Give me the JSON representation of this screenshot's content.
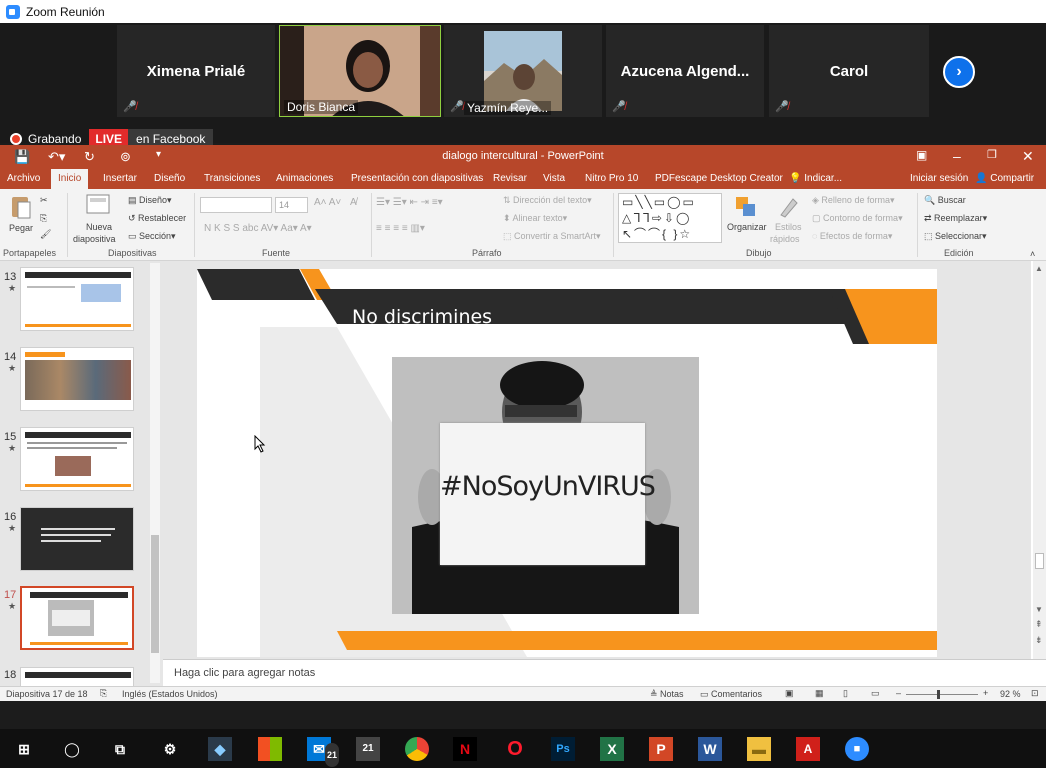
{
  "window": {
    "title": "Zoom Reunión"
  },
  "participants": [
    {
      "name": "Ximena Prialé",
      "muted": true
    },
    {
      "name": "Doris Bianca",
      "muted": false,
      "video": true
    },
    {
      "name": "Yazmín Reye...",
      "muted": true,
      "photo": true
    },
    {
      "name": "Azucena  Algend...",
      "muted": true
    },
    {
      "name": "Carol",
      "muted": true
    }
  ],
  "recording": {
    "label": "Grabando",
    "live": "LIVE",
    "platform": "en Facebook"
  },
  "ppt": {
    "title": "dialogo intercultural - PowerPoint",
    "tabs": [
      "Archivo",
      "Inicio",
      "Insertar",
      "Diseño",
      "Transiciones",
      "Animaciones",
      "Presentación con diapositivas",
      "Revisar",
      "Vista",
      "Nitro Pro 10",
      "PDFescape Desktop Creator",
      "Indicar...",
      "Iniciar sesión",
      "Compartir"
    ],
    "ribbon": {
      "paste": "Pegar",
      "new_slide_1": "Nueva",
      "new_slide_2": "diapositiva",
      "layout": "Diseño",
      "reset": "Restablecer",
      "section": "Sección",
      "font_size": "14",
      "text_dir": "Dirección del texto",
      "align_text": "Alinear texto",
      "convert_smartart": "Convertir a SmartArt",
      "arrange": "Organizar",
      "styles_1": "Estilos",
      "styles_2": "rápidos",
      "shape_fill": "Relleno de forma",
      "shape_outline": "Contorno de forma",
      "shape_effects": "Efectos de forma",
      "find": "Buscar",
      "replace": "Reemplazar",
      "select": "Seleccionar",
      "groups": [
        "Portapapeles",
        "Diapositivas",
        "Fuente",
        "Párrafo",
        "Dibujo",
        "Edición"
      ]
    },
    "thumbnails": [
      {
        "num": "13"
      },
      {
        "num": "14"
      },
      {
        "num": "15"
      },
      {
        "num": "16"
      },
      {
        "num": "17",
        "selected": true
      },
      {
        "num": "18"
      }
    ],
    "slide": {
      "heading": "No discrimines",
      "sign_text": "#NoSoyUnVIRUS"
    },
    "notes_placeholder": "Haga clic para agregar notas",
    "status": {
      "slide": "Diapositiva 17 de 18",
      "language": "Inglés (Estados Unidos)",
      "notes": "Notas",
      "comments": "Comentarios",
      "zoom": "92 %"
    }
  },
  "taskbar": {
    "badge_mail": "21",
    "badge_cal": "21"
  },
  "colors": {
    "ppt_accent": "#b7472a",
    "slide_orange": "#f7941d",
    "slide_dark": "#2b2b2b",
    "live_red": "#e22b2b",
    "zoom_blue": "#0e71eb"
  }
}
